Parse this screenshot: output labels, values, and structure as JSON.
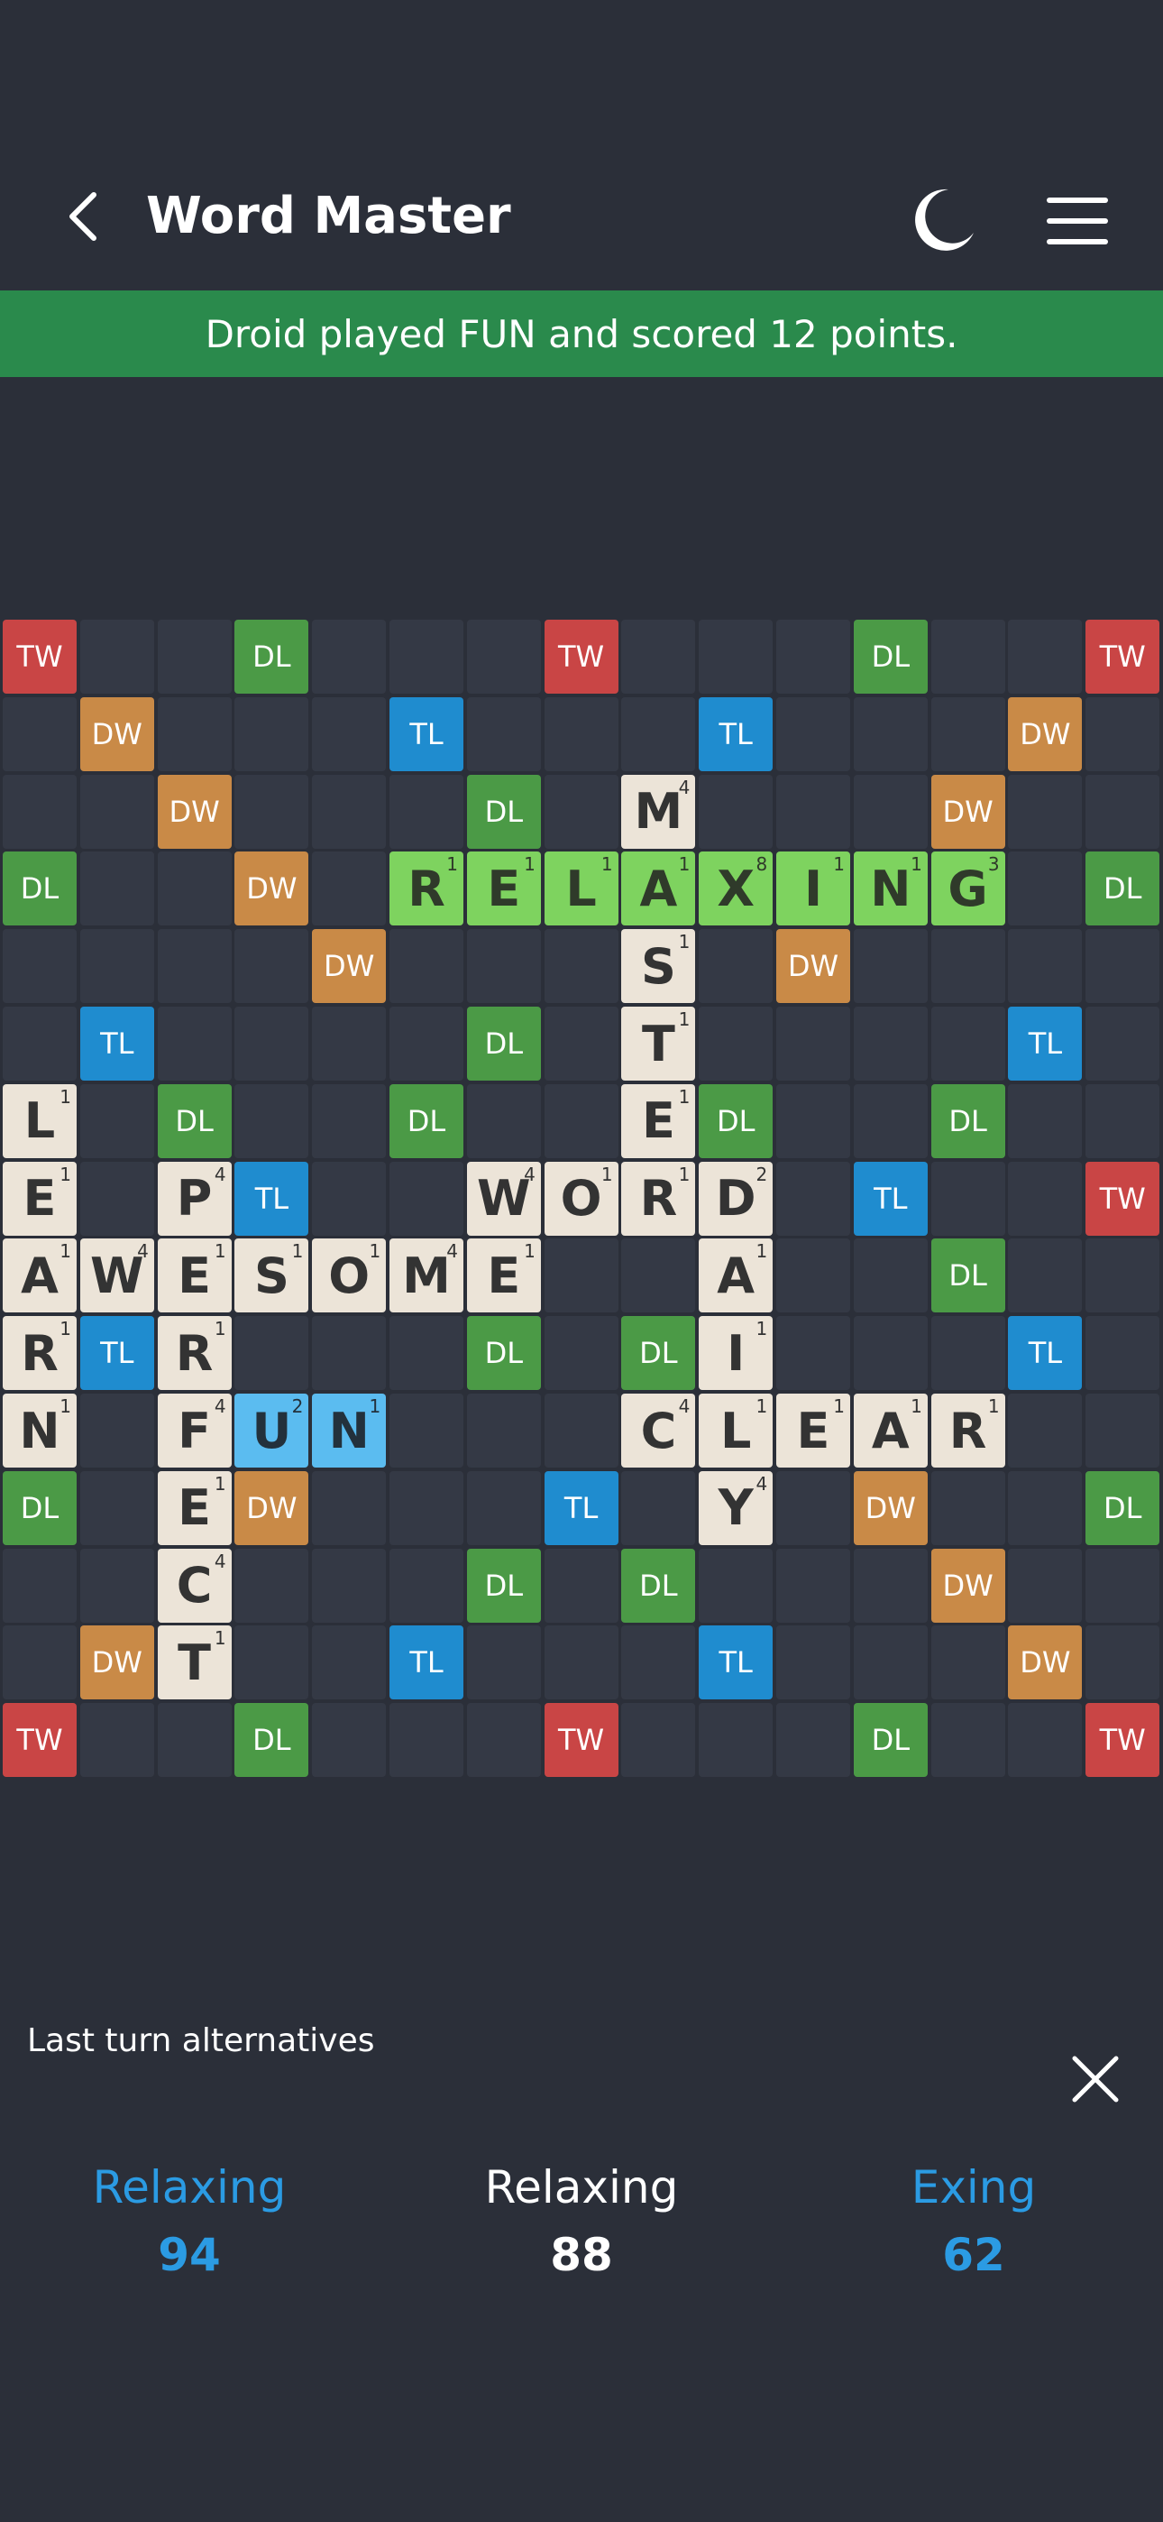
{
  "header": {
    "title": "Word Master",
    "back_icon": "chevron-left-icon",
    "theme_icon": "moon-icon",
    "menu_icon": "hamburger-menu-icon"
  },
  "banner": {
    "message": "Droid played FUN and scored 12 points.",
    "color": "#2a8a4c"
  },
  "colors": {
    "TW": "#c94545",
    "DW": "#c98a47",
    "TL": "#1f8ccf",
    "DL": "#4b9a46",
    "tile": "#ece4d8",
    "recent_tile": "#7ed35f",
    "last_play_tile": "#5bbcf0"
  },
  "board": {
    "size": 15,
    "premiums": [
      "TW..DL...TW...DL..TW",
      ".DW...TL...TL...DW.",
      "..DW...DL.M.DW.."
    ],
    "premium_grid": [
      [
        "TW",
        "",
        "",
        "DL",
        "",
        "",
        "",
        "TW",
        "",
        "",
        "",
        "DL",
        "",
        "",
        "TW"
      ],
      [
        "",
        "DW",
        "",
        "",
        "",
        "TL",
        "",
        "",
        "",
        "TL",
        "",
        "",
        "",
        "DW",
        ""
      ],
      [
        "",
        "",
        "DW",
        "",
        "",
        "",
        "DL",
        "",
        "",
        "",
        "",
        "",
        "DW",
        "",
        ""
      ],
      [
        "DL",
        "",
        "",
        "DW",
        "",
        "",
        "",
        "",
        "",
        "",
        "",
        "",
        "",
        "",
        "DL"
      ],
      [
        "",
        "",
        "",
        "",
        "DW",
        "",
        "",
        "",
        "",
        "",
        "DW",
        "",
        "",
        "",
        ""
      ],
      [
        "",
        "TL",
        "",
        "",
        "",
        "",
        "DL",
        "",
        "",
        "",
        "",
        "",
        "",
        "TL",
        ""
      ],
      [
        "",
        "",
        "DL",
        "",
        "",
        "DL",
        "",
        "",
        "",
        "DL",
        "",
        "",
        "DL",
        "",
        ""
      ],
      [
        "",
        "",
        "",
        "TL",
        "",
        "",
        "",
        "",
        "",
        "",
        "",
        "TL",
        "",
        "",
        "TW"
      ],
      [
        "",
        "",
        "",
        "",
        "",
        "",
        "",
        "",
        "",
        "",
        "",
        "",
        "DL",
        "",
        ""
      ],
      [
        "",
        "TL",
        "",
        "",
        "",
        "",
        "DL",
        "",
        "DL",
        "",
        "",
        "",
        "",
        "TL",
        ""
      ],
      [
        "",
        "",
        "",
        "",
        "",
        "",
        "",
        "",
        "",
        "",
        "",
        "",
        "",
        "",
        ""
      ],
      [
        "DL",
        "",
        "",
        "DW",
        "",
        "",
        "",
        "TL",
        "",
        "",
        "",
        "DW",
        "",
        "",
        "DL"
      ],
      [
        "",
        "",
        "",
        "",
        "",
        "",
        "DL",
        "",
        "DL",
        "",
        "",
        "",
        "DW",
        "",
        ""
      ],
      [
        "",
        "DW",
        "",
        "",
        "",
        "TL",
        "",
        "",
        "",
        "TL",
        "",
        "",
        "",
        "DW",
        ""
      ],
      [
        "TW",
        "",
        "",
        "DL",
        "",
        "",
        "",
        "TW",
        "",
        "",
        "",
        "DL",
        "",
        "",
        "TW"
      ]
    ],
    "tiles": [
      {
        "row": 2,
        "col": 8,
        "letter": "M",
        "points": "4",
        "style": "normal"
      },
      {
        "row": 3,
        "col": 5,
        "letter": "R",
        "points": "1",
        "style": "recent"
      },
      {
        "row": 3,
        "col": 6,
        "letter": "E",
        "points": "1",
        "style": "recent"
      },
      {
        "row": 3,
        "col": 7,
        "letter": "L",
        "points": "1",
        "style": "recent"
      },
      {
        "row": 3,
        "col": 8,
        "letter": "A",
        "points": "1",
        "style": "recent"
      },
      {
        "row": 3,
        "col": 9,
        "letter": "X",
        "points": "8",
        "style": "recent"
      },
      {
        "row": 3,
        "col": 10,
        "letter": "I",
        "points": "1",
        "style": "recent"
      },
      {
        "row": 3,
        "col": 11,
        "letter": "N",
        "points": "1",
        "style": "recent"
      },
      {
        "row": 3,
        "col": 12,
        "letter": "G",
        "points": "3",
        "style": "recent"
      },
      {
        "row": 4,
        "col": 8,
        "letter": "S",
        "points": "1",
        "style": "normal"
      },
      {
        "row": 5,
        "col": 8,
        "letter": "T",
        "points": "1",
        "style": "normal"
      },
      {
        "row": 6,
        "col": 0,
        "letter": "L",
        "points": "1",
        "style": "normal"
      },
      {
        "row": 6,
        "col": 8,
        "letter": "E",
        "points": "1",
        "style": "normal"
      },
      {
        "row": 7,
        "col": 0,
        "letter": "E",
        "points": "1",
        "style": "normal"
      },
      {
        "row": 7,
        "col": 2,
        "letter": "P",
        "points": "4",
        "style": "normal"
      },
      {
        "row": 7,
        "col": 6,
        "letter": "W",
        "points": "4",
        "style": "normal"
      },
      {
        "row": 7,
        "col": 7,
        "letter": "O",
        "points": "1",
        "style": "normal"
      },
      {
        "row": 7,
        "col": 8,
        "letter": "R",
        "points": "1",
        "style": "normal"
      },
      {
        "row": 7,
        "col": 9,
        "letter": "D",
        "points": "2",
        "style": "normal"
      },
      {
        "row": 8,
        "col": 0,
        "letter": "A",
        "points": "1",
        "style": "normal"
      },
      {
        "row": 8,
        "col": 1,
        "letter": "W",
        "points": "4",
        "style": "normal"
      },
      {
        "row": 8,
        "col": 2,
        "letter": "E",
        "points": "1",
        "style": "normal"
      },
      {
        "row": 8,
        "col": 3,
        "letter": "S",
        "points": "1",
        "style": "normal"
      },
      {
        "row": 8,
        "col": 4,
        "letter": "O",
        "points": "1",
        "style": "normal"
      },
      {
        "row": 8,
        "col": 5,
        "letter": "M",
        "points": "4",
        "style": "normal"
      },
      {
        "row": 8,
        "col": 6,
        "letter": "E",
        "points": "1",
        "style": "normal"
      },
      {
        "row": 8,
        "col": 9,
        "letter": "A",
        "points": "1",
        "style": "normal"
      },
      {
        "row": 9,
        "col": 0,
        "letter": "R",
        "points": "1",
        "style": "normal"
      },
      {
        "row": 9,
        "col": 2,
        "letter": "R",
        "points": "1",
        "style": "normal"
      },
      {
        "row": 9,
        "col": 9,
        "letter": "I",
        "points": "1",
        "style": "normal"
      },
      {
        "row": 10,
        "col": 0,
        "letter": "N",
        "points": "1",
        "style": "normal"
      },
      {
        "row": 10,
        "col": 2,
        "letter": "F",
        "points": "4",
        "style": "normal"
      },
      {
        "row": 10,
        "col": 3,
        "letter": "U",
        "points": "2",
        "style": "last"
      },
      {
        "row": 10,
        "col": 4,
        "letter": "N",
        "points": "1",
        "style": "last"
      },
      {
        "row": 10,
        "col": 8,
        "letter": "C",
        "points": "4",
        "style": "normal"
      },
      {
        "row": 10,
        "col": 9,
        "letter": "L",
        "points": "1",
        "style": "normal"
      },
      {
        "row": 10,
        "col": 10,
        "letter": "E",
        "points": "1",
        "style": "normal"
      },
      {
        "row": 10,
        "col": 11,
        "letter": "A",
        "points": "1",
        "style": "normal"
      },
      {
        "row": 10,
        "col": 12,
        "letter": "R",
        "points": "1",
        "style": "normal"
      },
      {
        "row": 11,
        "col": 2,
        "letter": "E",
        "points": "1",
        "style": "normal"
      },
      {
        "row": 11,
        "col": 9,
        "letter": "Y",
        "points": "4",
        "style": "normal"
      },
      {
        "row": 12,
        "col": 2,
        "letter": "C",
        "points": "4",
        "style": "normal"
      },
      {
        "row": 13,
        "col": 2,
        "letter": "T",
        "points": "1",
        "style": "normal"
      }
    ]
  },
  "alternatives": {
    "title": "Last turn alternatives",
    "close_icon": "close-icon",
    "items": [
      {
        "word": "Relaxing",
        "score": "94",
        "color": "blue"
      },
      {
        "word": "Relaxing",
        "score": "88",
        "color": "white"
      },
      {
        "word": "Exing",
        "score": "62",
        "color": "blue"
      }
    ]
  }
}
